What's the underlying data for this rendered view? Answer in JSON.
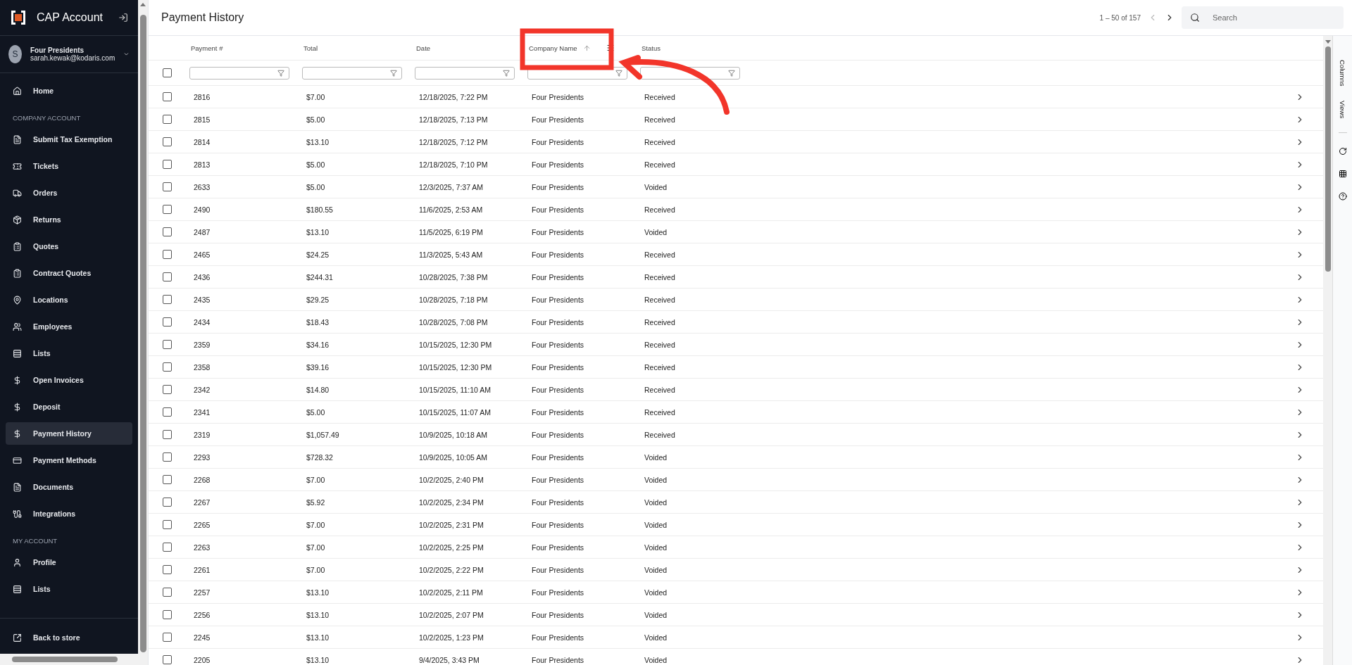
{
  "sidebar": {
    "app_title": "CAP Account",
    "user": {
      "initial": "S",
      "name": "Four Presidents",
      "email": "sarah.kewak@kodaris.com"
    },
    "top_items": [
      {
        "label": "Home",
        "selected": false
      }
    ],
    "sections": [
      {
        "title": "COMPANY ACCOUNT",
        "items": [
          {
            "label": "Submit Tax Exemption",
            "selected": false
          },
          {
            "label": "Tickets",
            "selected": false
          },
          {
            "label": "Orders",
            "selected": false
          },
          {
            "label": "Returns",
            "selected": false
          },
          {
            "label": "Quotes",
            "selected": false
          },
          {
            "label": "Contract Quotes",
            "selected": false
          },
          {
            "label": "Locations",
            "selected": false
          },
          {
            "label": "Employees",
            "selected": false
          },
          {
            "label": "Lists",
            "selected": false
          },
          {
            "label": "Open Invoices",
            "selected": false
          },
          {
            "label": "Deposit",
            "selected": false
          },
          {
            "label": "Payment History",
            "selected": true
          },
          {
            "label": "Payment Methods",
            "selected": false
          },
          {
            "label": "Documents",
            "selected": false
          },
          {
            "label": "Integrations",
            "selected": false
          }
        ]
      },
      {
        "title": "MY ACCOUNT",
        "items": [
          {
            "label": "Profile",
            "selected": false
          },
          {
            "label": "Lists",
            "selected": false
          }
        ]
      }
    ],
    "footer_item": {
      "label": "Back to store"
    }
  },
  "header": {
    "title": "Payment History",
    "pagination": "1 – 50 of 157",
    "prev_disabled": true,
    "next_disabled": false,
    "search": {
      "placeholder": "Search"
    }
  },
  "table": {
    "select_all_checked": false,
    "columns": [
      {
        "label": "Payment #",
        "sorted": false
      },
      {
        "label": "Total",
        "sorted": false
      },
      {
        "label": "Date",
        "sorted": false
      },
      {
        "label": "Company Name",
        "sorted": true
      },
      {
        "label": "Status",
        "sorted": false
      }
    ],
    "rows": [
      {
        "checked": false,
        "cells": [
          "2816",
          "$7.00",
          "12/18/2025, 7:22 PM",
          "Four Presidents",
          "Received"
        ]
      },
      {
        "checked": false,
        "cells": [
          "2815",
          "$5.00",
          "12/18/2025, 7:13 PM",
          "Four Presidents",
          "Received"
        ]
      },
      {
        "checked": false,
        "cells": [
          "2814",
          "$13.10",
          "12/18/2025, 7:12 PM",
          "Four Presidents",
          "Received"
        ]
      },
      {
        "checked": false,
        "cells": [
          "2813",
          "$5.00",
          "12/18/2025, 7:10 PM",
          "Four Presidents",
          "Received"
        ]
      },
      {
        "checked": false,
        "cells": [
          "2633",
          "$5.00",
          "12/3/2025, 7:37 AM",
          "Four Presidents",
          "Voided"
        ]
      },
      {
        "checked": false,
        "cells": [
          "2490",
          "$180.55",
          "11/6/2025, 2:53 AM",
          "Four Presidents",
          "Received"
        ]
      },
      {
        "checked": false,
        "cells": [
          "2487",
          "$13.10",
          "11/5/2025, 6:19 PM",
          "Four Presidents",
          "Voided"
        ]
      },
      {
        "checked": false,
        "cells": [
          "2465",
          "$24.25",
          "11/3/2025, 5:43 AM",
          "Four Presidents",
          "Received"
        ]
      },
      {
        "checked": false,
        "cells": [
          "2436",
          "$244.31",
          "10/28/2025, 7:38 PM",
          "Four Presidents",
          "Received"
        ]
      },
      {
        "checked": false,
        "cells": [
          "2435",
          "$29.25",
          "10/28/2025, 7:18 PM",
          "Four Presidents",
          "Received"
        ]
      },
      {
        "checked": false,
        "cells": [
          "2434",
          "$18.43",
          "10/28/2025, 7:08 PM",
          "Four Presidents",
          "Received"
        ]
      },
      {
        "checked": false,
        "cells": [
          "2359",
          "$34.16",
          "10/15/2025, 12:30 PM",
          "Four Presidents",
          "Received"
        ]
      },
      {
        "checked": false,
        "cells": [
          "2358",
          "$39.16",
          "10/15/2025, 12:30 PM",
          "Four Presidents",
          "Received"
        ]
      },
      {
        "checked": false,
        "cells": [
          "2342",
          "$14.80",
          "10/15/2025, 11:10 AM",
          "Four Presidents",
          "Received"
        ]
      },
      {
        "checked": false,
        "cells": [
          "2341",
          "$5.00",
          "10/15/2025, 11:07 AM",
          "Four Presidents",
          "Received"
        ]
      },
      {
        "checked": false,
        "cells": [
          "2319",
          "$1,057.49",
          "10/9/2025, 10:18 AM",
          "Four Presidents",
          "Received"
        ]
      },
      {
        "checked": false,
        "cells": [
          "2293",
          "$728.32",
          "10/9/2025, 10:05 AM",
          "Four Presidents",
          "Voided"
        ]
      },
      {
        "checked": false,
        "cells": [
          "2268",
          "$7.00",
          "10/2/2025, 2:40 PM",
          "Four Presidents",
          "Voided"
        ]
      },
      {
        "checked": false,
        "cells": [
          "2267",
          "$5.92",
          "10/2/2025, 2:34 PM",
          "Four Presidents",
          "Voided"
        ]
      },
      {
        "checked": false,
        "cells": [
          "2265",
          "$7.00",
          "10/2/2025, 2:31 PM",
          "Four Presidents",
          "Voided"
        ]
      },
      {
        "checked": false,
        "cells": [
          "2263",
          "$7.00",
          "10/2/2025, 2:25 PM",
          "Four Presidents",
          "Voided"
        ]
      },
      {
        "checked": false,
        "cells": [
          "2261",
          "$7.00",
          "10/2/2025, 2:22 PM",
          "Four Presidents",
          "Voided"
        ]
      },
      {
        "checked": false,
        "cells": [
          "2257",
          "$13.10",
          "10/2/2025, 2:11 PM",
          "Four Presidents",
          "Voided"
        ]
      },
      {
        "checked": false,
        "cells": [
          "2256",
          "$13.10",
          "10/2/2025, 2:07 PM",
          "Four Presidents",
          "Voided"
        ]
      },
      {
        "checked": false,
        "cells": [
          "2245",
          "$13.10",
          "10/2/2025, 1:23 PM",
          "Four Presidents",
          "Voided"
        ]
      },
      {
        "checked": false,
        "cells": [
          "2205",
          "$13.10",
          "9/4/2025, 3:43 PM",
          "Four Presidents",
          "Voided"
        ]
      }
    ]
  },
  "side_rail": {
    "tabs": [
      "Columns",
      "Views"
    ]
  },
  "annotation": {
    "kind": "box-arrow"
  }
}
